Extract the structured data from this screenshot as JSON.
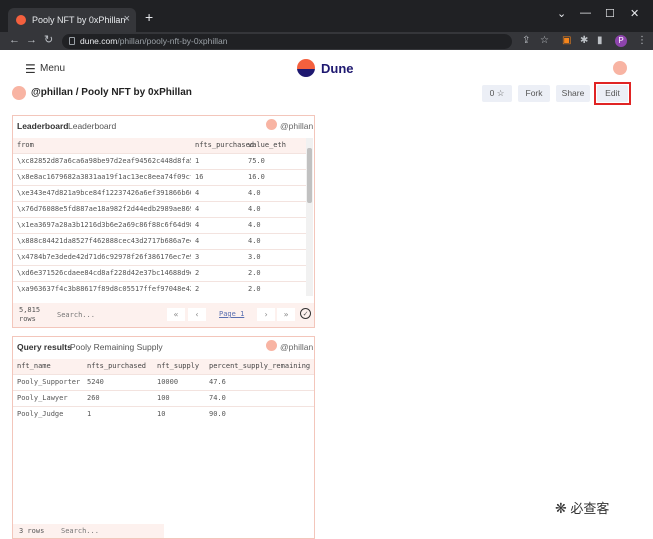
{
  "browser": {
    "tab_title": "Pooly NFT by 0xPhillan",
    "url_domain": "dune.com",
    "url_path": "/phillan/pooly-nft-by-0xphillan",
    "profile_initial": "P"
  },
  "header": {
    "menu_label": "Menu",
    "brand": "Dune"
  },
  "page": {
    "breadcrumb": "@phillan / Pooly NFT by 0xPhillan",
    "star_count": "0 ☆",
    "fork_label": "Fork",
    "share_label": "Share",
    "edit_label": "Edit"
  },
  "leaderboard": {
    "type_label": "Leaderboard",
    "title": "Leaderboard",
    "owner": "@phillan",
    "columns": [
      "from",
      "nfts_purchased",
      "value_eth"
    ],
    "rows": [
      [
        "\\xc82852d87a6ca6a98be97d2eaf94562c448d8fa5",
        "1",
        "75.0"
      ],
      [
        "\\x8e8ac1679682a3831aa19f1ac13ec8eea74f09cf",
        "16",
        "16.0"
      ],
      [
        "\\xe343e47d821a9bce84f12237426a6ef391866b60",
        "4",
        "4.0"
      ],
      [
        "\\x76d76088e5fd887ae18a982f2d44edb2989ae869",
        "4",
        "4.0"
      ],
      [
        "\\x1ea3697a28a3b1216d3b6e2a69c86f88c6f64d98",
        "4",
        "4.0"
      ],
      [
        "\\x888c84421da8527f462888cec43d2717b686a7e4",
        "4",
        "4.0"
      ],
      [
        "\\x4784b7e3dede42d71d6c92978f26f386176ec7e9",
        "3",
        "3.0"
      ],
      [
        "\\xd6e371526cdaee84cd8af228d42e37bc14688d9e",
        "2",
        "2.0"
      ],
      [
        "\\xa963637f4c3b88617f89d8c05517ffef97048e42",
        "2",
        "2.0"
      ]
    ],
    "row_count": "5,815",
    "rows_label": "rows",
    "search_placeholder": "Search...",
    "page_label": "Page 1"
  },
  "query_results": {
    "type_label": "Query results",
    "title": "Pooly Remaining Supply",
    "owner": "@phillan",
    "columns": [
      "nft_name",
      "nfts_purchased",
      "nft_supply",
      "percent_supply_remaining"
    ],
    "rows": [
      [
        "Pooly_Supporter",
        "5240",
        "10000",
        "47.6"
      ],
      [
        "Pooly_Lawyer",
        "260",
        "100",
        "74.0"
      ],
      [
        "Pooly_Judge",
        "1",
        "10",
        "90.0"
      ]
    ],
    "row_count": "3 rows",
    "search_placeholder": "Search..."
  },
  "watermark": "必查客"
}
